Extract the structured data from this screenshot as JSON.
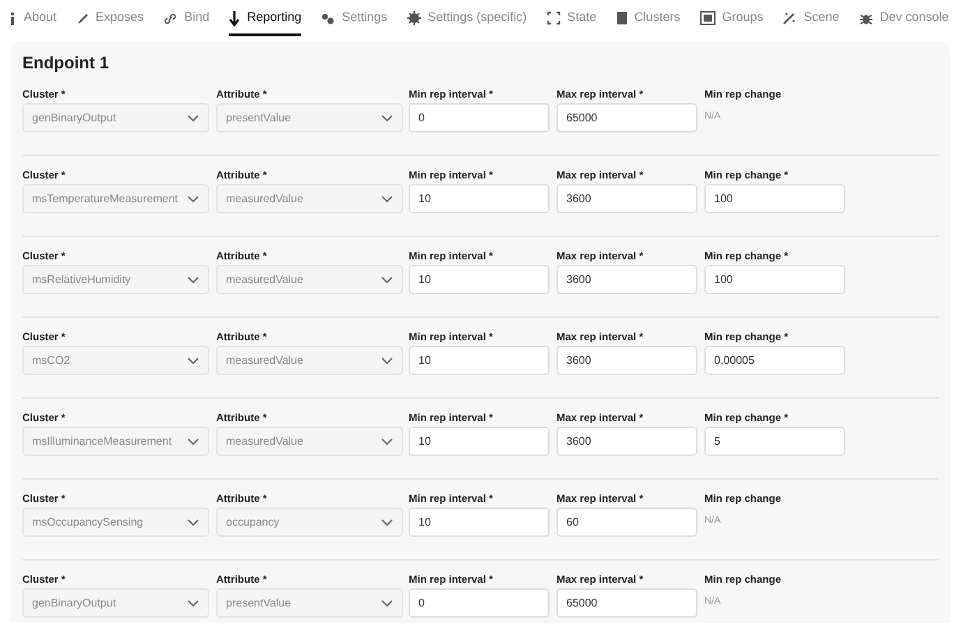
{
  "tabs": [
    {
      "label": "About",
      "selected": false
    },
    {
      "label": "Exposes",
      "selected": false
    },
    {
      "label": "Bind",
      "selected": false
    },
    {
      "label": "Reporting",
      "selected": true
    },
    {
      "label": "Settings",
      "selected": false
    },
    {
      "label": "Settings (specific)",
      "selected": false
    },
    {
      "label": "State",
      "selected": false
    },
    {
      "label": "Clusters",
      "selected": false
    },
    {
      "label": "Groups",
      "selected": false
    },
    {
      "label": "Scene",
      "selected": false
    },
    {
      "label": "Dev console",
      "selected": false
    }
  ],
  "endpoint": {
    "title": "Endpoint 1",
    "rows": [
      {
        "cluster_label": "Cluster *",
        "cluster": "genBinaryOutput",
        "attribute_label": "Attribute *",
        "attribute": "presentValue",
        "min_label": "Min rep interval *",
        "min": "0",
        "max_label": "Max rep interval *",
        "max": "65000",
        "change_label": "Min rep change",
        "change": {
          "kind": "text",
          "value": "N/A"
        }
      },
      {
        "cluster_label": "Cluster *",
        "cluster": "msTemperatureMeasurement",
        "attribute_label": "Attribute *",
        "attribute": "measuredValue",
        "min_label": "Min rep interval *",
        "min": "10",
        "max_label": "Max rep interval *",
        "max": "3600",
        "change_label": "Min rep change *",
        "change": {
          "kind": "input",
          "value": "100"
        }
      },
      {
        "cluster_label": "Cluster *",
        "cluster": "msRelativeHumidity",
        "attribute_label": "Attribute *",
        "attribute": "measuredValue",
        "min_label": "Min rep interval *",
        "min": "10",
        "max_label": "Max rep interval *",
        "max": "3600",
        "change_label": "Min rep change *",
        "change": {
          "kind": "input",
          "value": "100"
        }
      },
      {
        "cluster_label": "Cluster *",
        "cluster": "msCO2",
        "attribute_label": "Attribute *",
        "attribute": "measuredValue",
        "min_label": "Min rep interval *",
        "min": "10",
        "max_label": "Max rep interval *",
        "max": "3600",
        "change_label": "Min rep change *",
        "change": {
          "kind": "input",
          "value": "0,00005"
        }
      },
      {
        "cluster_label": "Cluster *",
        "cluster": "msIlluminanceMeasurement",
        "attribute_label": "Attribute *",
        "attribute": "measuredValue",
        "min_label": "Min rep interval *",
        "min": "10",
        "max_label": "Max rep interval *",
        "max": "3600",
        "change_label": "Min rep change *",
        "change": {
          "kind": "input",
          "value": "5"
        }
      },
      {
        "cluster_label": "Cluster *",
        "cluster": "msOccupancySensing",
        "attribute_label": "Attribute *",
        "attribute": "occupancy",
        "min_label": "Min rep interval *",
        "min": "10",
        "max_label": "Max rep interval *",
        "max": "60",
        "change_label": "Min rep change",
        "change": {
          "kind": "text",
          "value": "N/A"
        }
      },
      {
        "cluster_label": "Cluster *",
        "cluster": "genBinaryOutput",
        "attribute_label": "Attribute *",
        "attribute": "presentValue",
        "min_label": "Min rep interval *",
        "min": "0",
        "max_label": "Max rep interval *",
        "max": "65000",
        "change_label": "Min rep change",
        "change": {
          "kind": "text",
          "value": "N/A"
        }
      }
    ]
  }
}
